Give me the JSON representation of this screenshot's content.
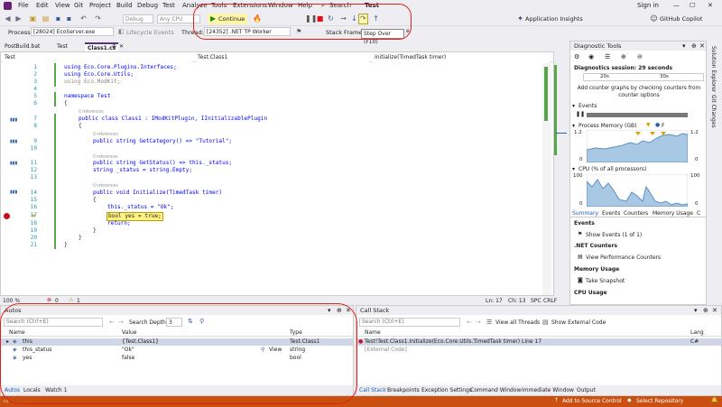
{
  "menu": {
    "items": [
      "File",
      "Edit",
      "View",
      "Git",
      "Project",
      "Build",
      "Debug",
      "Test",
      "Analyze",
      "Tools",
      "Extensions",
      "Window",
      "Help"
    ],
    "search_label": "Search",
    "active_title": "Test",
    "sign_in": "Sign in"
  },
  "toolbar": {
    "config": "Debug",
    "platform": "Any CPU",
    "continue_label": "Continue",
    "app_insights": "Application Insights",
    "copilot": "GitHub Copilot",
    "tooltip": "Step Over (F10)"
  },
  "debugbar": {
    "process_label": "Process:",
    "process_value": "[28024] EcoServer.exe",
    "lifecycle": "Lifecycle Events",
    "thread_label": "Thread:",
    "thread_value": "[24352] .NET TP Worker",
    "stackframe_label": "Stack Frame:",
    "stackframe_value": "e"
  },
  "doctabs": [
    "PostBuild.bat",
    "Test",
    "Class1.cs"
  ],
  "editor": {
    "nav_project": "Test",
    "nav_class": "Test.Class1",
    "nav_member": "Initialize(TimedTask timer)",
    "zoom": "100 %",
    "issues": "0",
    "warnings": "1",
    "position": {
      "ln": "Ln: 17",
      "ch": "Ch: 13",
      "spc": "SPC",
      "crlf": "CRLF"
    },
    "lines": [
      {
        "n": "1",
        "text": "using Eco.Core.Plugins.Interfaces;"
      },
      {
        "n": "2",
        "text": "using Eco.Core.Utils;"
      },
      {
        "n": "3",
        "text": "using Eco.ModKit;"
      },
      {
        "n": "4",
        "text": ""
      },
      {
        "n": "5",
        "text": "namespace Test"
      },
      {
        "n": "6",
        "text": "{"
      },
      {
        "n": "7",
        "text": "public class Class1 : IModKitPlugin, IInitializablePlugin"
      },
      {
        "n": "8",
        "text": "{"
      },
      {
        "n": "9",
        "text": "public string GetCategory() => \"Tutorial\";"
      },
      {
        "n": "10",
        "text": ""
      },
      {
        "n": "11",
        "text": "public string GetStatus() => this._status;"
      },
      {
        "n": "12",
        "text": "string _status = string.Empty;"
      },
      {
        "n": "13",
        "text": ""
      },
      {
        "n": "14",
        "text": "public void Initialize(TimedTask timer)"
      },
      {
        "n": "15",
        "text": "{"
      },
      {
        "n": "16",
        "text": "this._status = \"Ok\";"
      },
      {
        "n": "17",
        "text": "bool yes = true;"
      },
      {
        "n": "18",
        "text": "return;"
      },
      {
        "n": "19",
        "text": "}"
      },
      {
        "n": "20",
        "text": "}"
      },
      {
        "n": "21",
        "text": "}"
      }
    ],
    "refs": [
      "0 references",
      "0 references",
      "0 references",
      "0 references"
    ]
  },
  "autos": {
    "title": "Autos",
    "search_placeholder": "Search (Ctrl+E)",
    "depth_label": "Search Depth:",
    "depth_value": "3",
    "columns": [
      "Name",
      "Value",
      "Type"
    ],
    "rows": [
      {
        "name": "this",
        "value": "{Test.Class1}",
        "type": "Test.Class1"
      },
      {
        "name": "this_status",
        "value": "\"Ok\"",
        "type": "string",
        "view": "View"
      },
      {
        "name": "yes",
        "value": "false",
        "type": "bool"
      }
    ],
    "tabs": [
      "Autos",
      "Locals",
      "Watch 1"
    ]
  },
  "callstack": {
    "title": "Call Stack",
    "search_placeholder": "Search (Ctrl+E)",
    "view_threads": "View all Threads",
    "show_external": "Show External Code",
    "columns": [
      "Name",
      "Lang"
    ],
    "rows": [
      {
        "name": "Test!Test.Class1.Initialize(Eco.Core.Utils.TimedTask timer) Line 17",
        "lang": "C#"
      },
      {
        "name": "[External Code]",
        "lang": ""
      }
    ],
    "tabs": [
      "Call Stack",
      "Breakpoints",
      "Exception Settings",
      "Command Window",
      "Immediate Window",
      "Output"
    ]
  },
  "diagnostics": {
    "title": "Diagnostic Tools",
    "session": "Diagnostics session: 29 seconds",
    "t20": "20s",
    "t30": "30s",
    "add_graphs": "Add counter graphs by checking counters from counter options",
    "events": "Events",
    "memory": "Process Memory (GB)",
    "memory_f": "F",
    "mem_top_l": "1.2",
    "mem_top_r": "1.2",
    "mem_bot_l": "0",
    "mem_bot_r": "0",
    "cpu": "CPU (% of all processors)",
    "cpu_top_l": "100",
    "cpu_top_r": "100",
    "cpu_bot_l": "0",
    "cpu_bot_r": "0",
    "tabs": [
      "Summary",
      "Events",
      "Counters",
      "Memory Usage",
      "C"
    ],
    "sections": [
      {
        "title": "Events",
        "item": "Show Events (1 of 1)"
      },
      {
        "title": ".NET Counters",
        "item": "View Performance Counters"
      },
      {
        "title": "Memory Usage",
        "item": "Take Snapshot"
      },
      {
        "title": "CPU Usage",
        "item": ""
      }
    ]
  },
  "rightstrip": [
    "Solution Explorer",
    "Git Changes"
  ],
  "status": {
    "add_source": "Add to Source Control",
    "select_repo": "Select Repository"
  }
}
